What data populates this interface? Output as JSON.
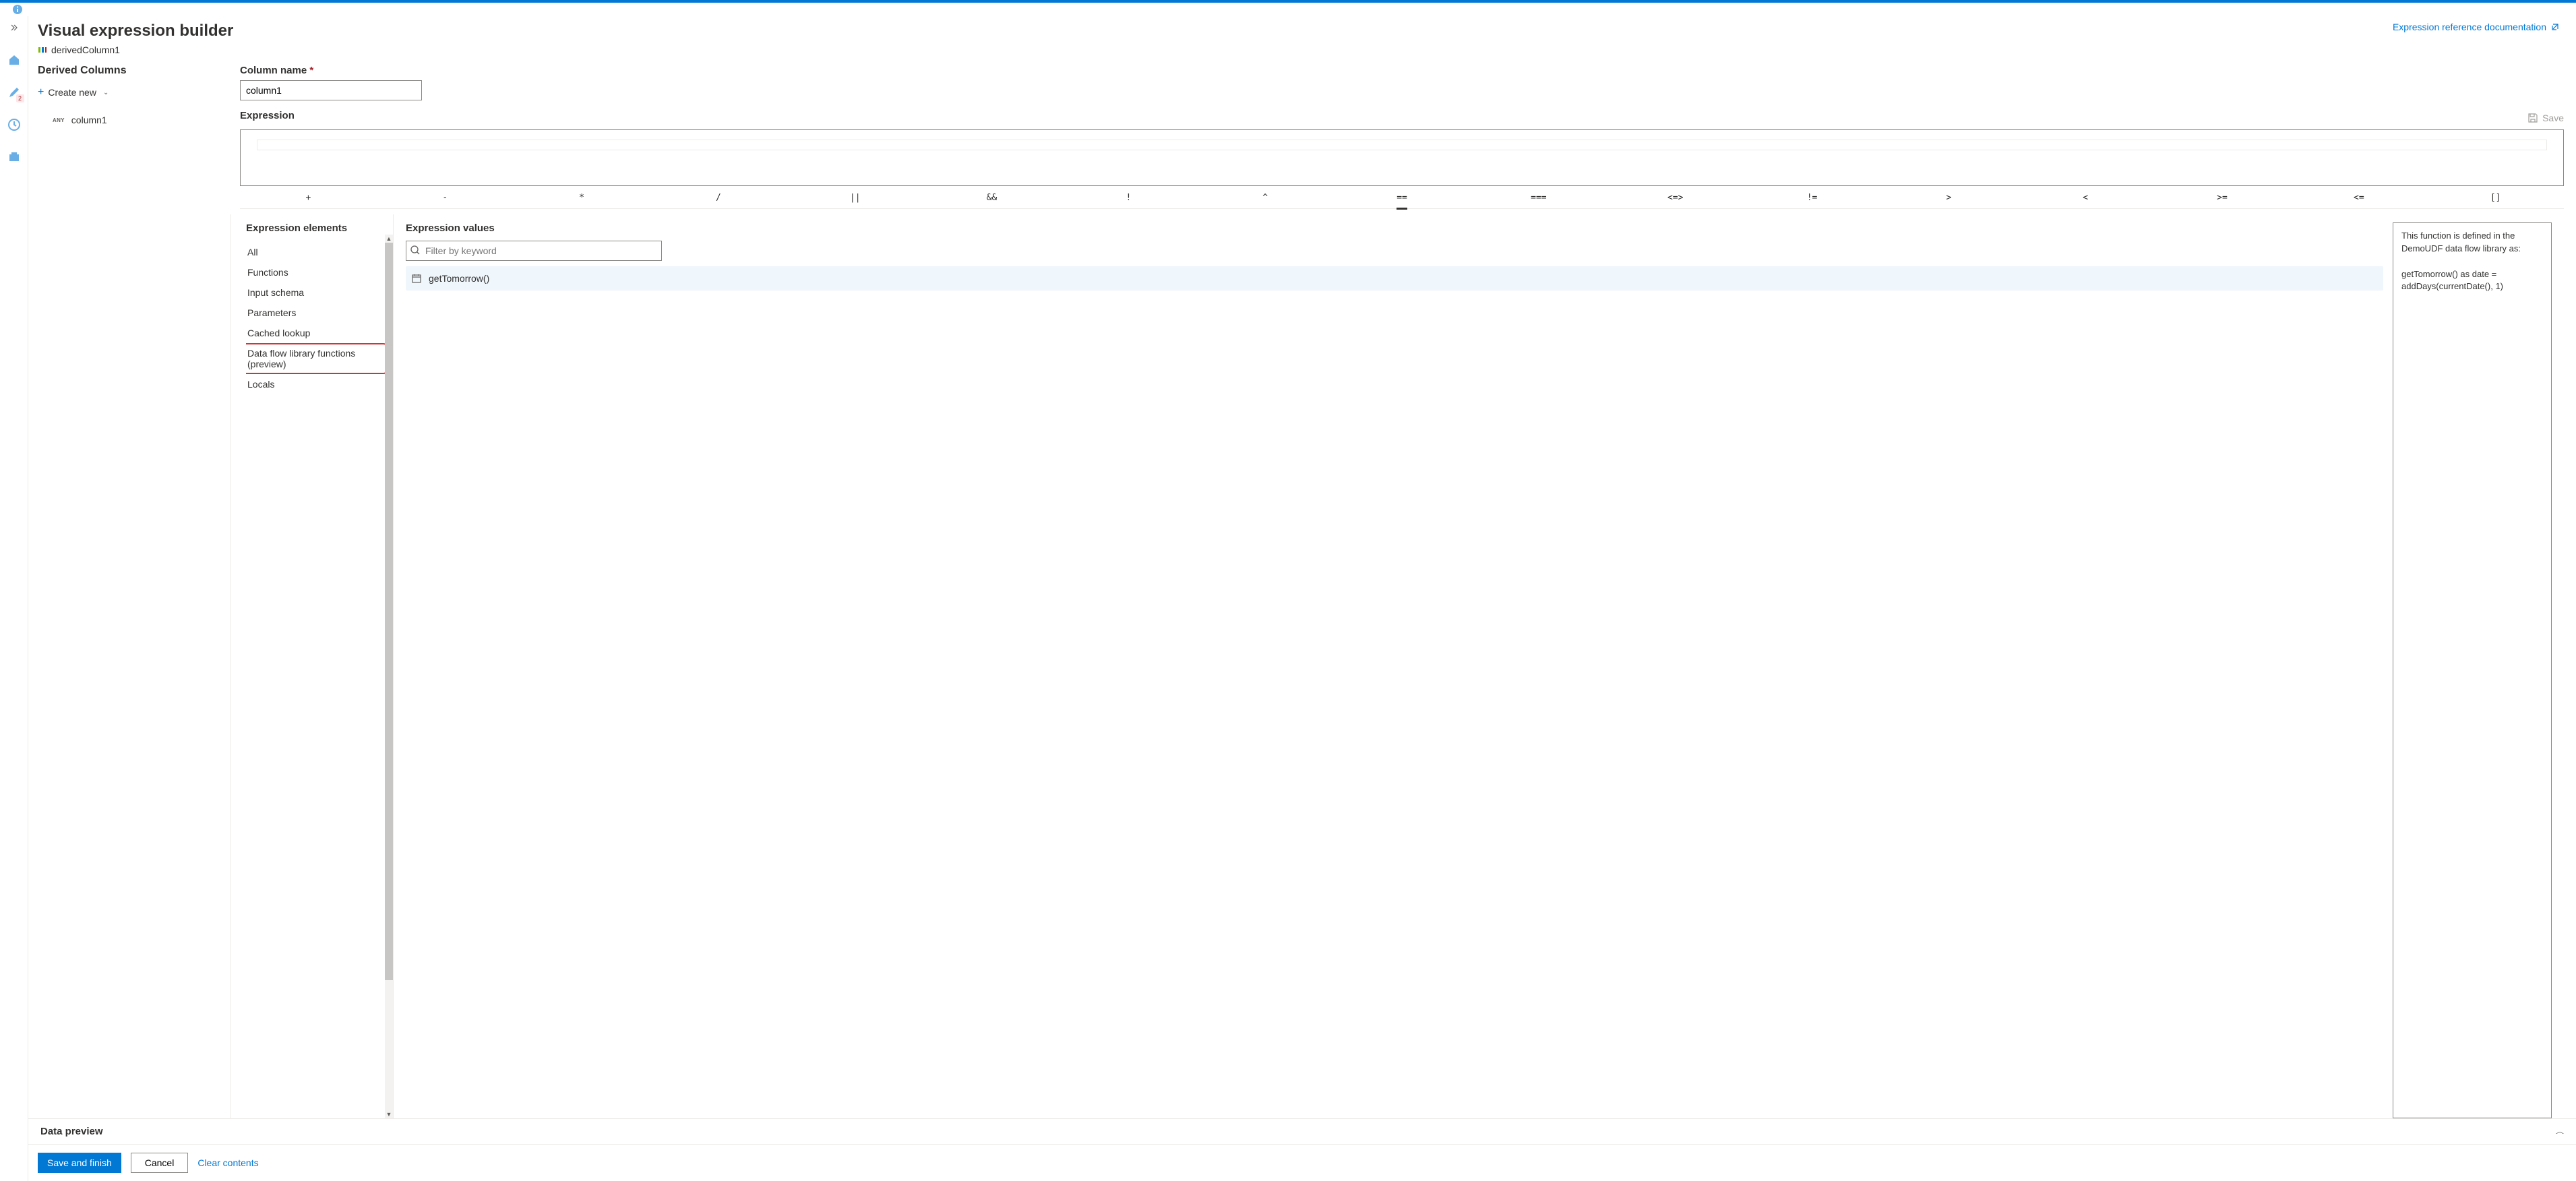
{
  "sidebar": {
    "edit_badge": "2"
  },
  "header": {
    "title": "Visual expression builder",
    "transformation": "derivedColumn1",
    "doc_link": "Expression reference documentation"
  },
  "derived": {
    "heading": "Derived Columns",
    "create_new": "Create new",
    "columns": [
      {
        "type": "ANY",
        "name": "column1"
      }
    ]
  },
  "column_form": {
    "name_label": "Column name",
    "name_value": "column1",
    "expr_label": "Expression",
    "save": "Save"
  },
  "operators": [
    "+",
    "-",
    "*",
    "/",
    "||",
    "&&",
    "!",
    "^",
    "==",
    "===",
    "<=>",
    "!=",
    ">",
    "<",
    ">=",
    "<=",
    "[]"
  ],
  "elements": {
    "heading": "Expression elements",
    "items": [
      "All",
      "Functions",
      "Input schema",
      "Parameters",
      "Cached lookup",
      "Data flow library functions (preview)",
      "Locals"
    ],
    "selected": "Data flow library functions (preview)"
  },
  "values": {
    "heading": "Expression values",
    "filter_placeholder": "Filter by keyword",
    "items": [
      {
        "name": "getTomorrow()"
      }
    ],
    "description": "This function is defined in the DemoUDF data flow library as:\n\ngetTomorrow() as date = addDays(currentDate(), 1)"
  },
  "data_preview": {
    "label": "Data preview"
  },
  "footer": {
    "save": "Save and finish",
    "cancel": "Cancel",
    "clear": "Clear contents"
  }
}
